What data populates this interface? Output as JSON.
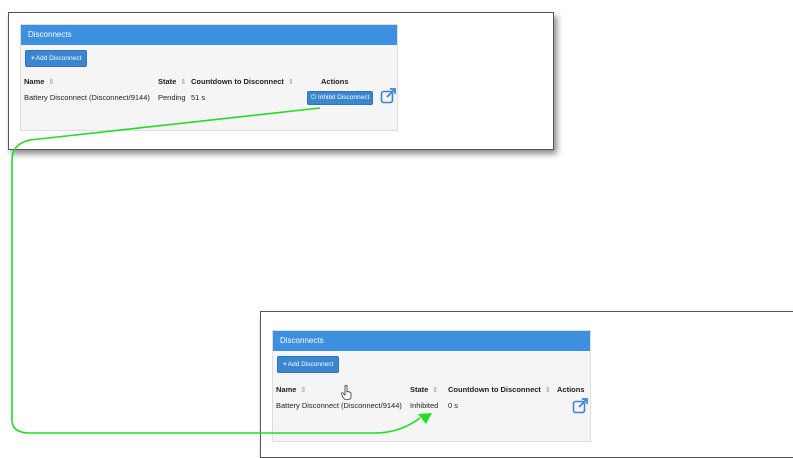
{
  "before": {
    "panel_title": "Disconnects",
    "add_button": "Add Disconnect",
    "add_icon": "plus-icon",
    "columns": {
      "name": "Name",
      "state": "State",
      "countdown": "Countdown to Disconnect",
      "actions": "Actions"
    },
    "sort_icon": "⇕",
    "row": {
      "name": "Battery Disconnect (Disconnect/9144)",
      "state": "Pending",
      "countdown": "51 s",
      "action_button": "Inhibit Disconnect"
    },
    "action_icon": "power-icon",
    "external_icon": "external-link-icon"
  },
  "after": {
    "panel_title": "Disconnects",
    "add_button": "Add Disconnect",
    "columns": {
      "name": "Name",
      "state": "State",
      "countdown": "Countdown to Disconnect",
      "actions": "Actions"
    },
    "sort_icon": "⇕",
    "row": {
      "name": "Battery Disconnect (Disconnect/9144)",
      "state": "Inhibited",
      "countdown": "0 s"
    },
    "external_icon": "external-link-icon",
    "cursor_icon": "hand-pointer-icon"
  },
  "colors": {
    "header": "#3d8fe0",
    "button": "#3a86d0",
    "arrow": "#22dd22"
  }
}
